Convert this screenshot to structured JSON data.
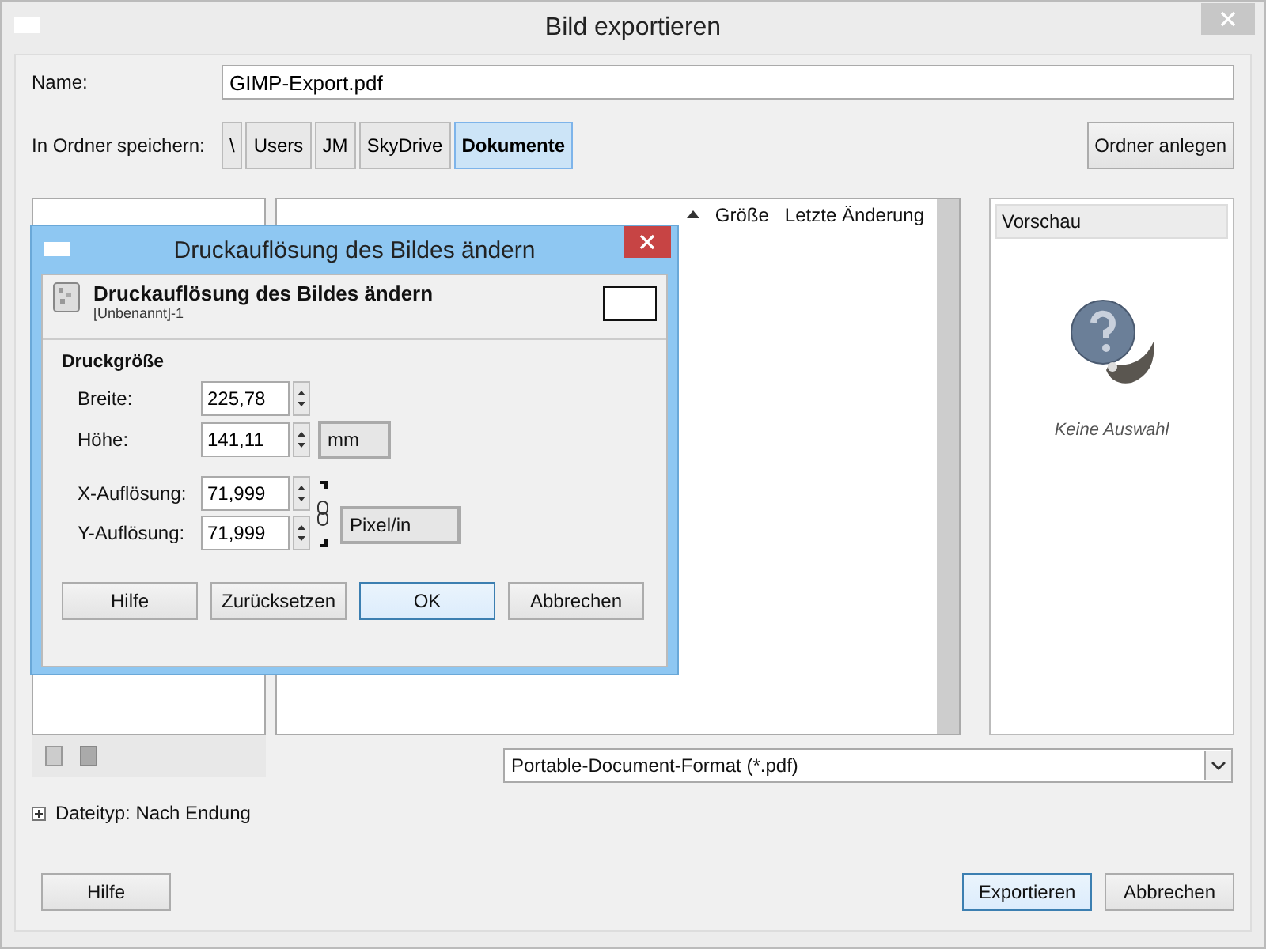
{
  "window": {
    "title": "Bild exportieren"
  },
  "name_field": {
    "label": "Name:",
    "value": "GIMP-Export.pdf"
  },
  "folder": {
    "label": "In Ordner speichern:",
    "crumbs": [
      {
        "label": "\\",
        "selected": false
      },
      {
        "label": "Users",
        "selected": false
      },
      {
        "label": "JM",
        "selected": false
      },
      {
        "label": "SkyDrive",
        "selected": false
      },
      {
        "label": "Dokumente",
        "selected": true
      }
    ],
    "create_button": "Ordner anlegen"
  },
  "file_list": {
    "columns": [
      "Größe",
      "Letzte Änderung"
    ]
  },
  "preview": {
    "title": "Vorschau",
    "caption": "Keine Auswahl"
  },
  "filetype_select": "Portable-Document-Format (*.pdf)",
  "filetype_expander": {
    "label": "Dateityp: Nach Endung",
    "expanded": false
  },
  "buttons": [
    {
      "label": "Hilfe",
      "default": false
    },
    {
      "label": "Exportieren",
      "default": true
    },
    {
      "label": "Abbrechen",
      "default": false
    }
  ],
  "dialog": {
    "title": "Druckauflösung des Bildes ändern",
    "heading": "Druckauflösung des Bildes ändern",
    "subheading": "[Unbenannt]-1",
    "section": "Druckgröße",
    "fields": [
      {
        "label": "Breite:",
        "value": "225,78"
      },
      {
        "label": "Höhe:",
        "value": "141,11"
      },
      {
        "label": "X-Auflösung:",
        "value": "71,999"
      },
      {
        "label": "Y-Auflösung:",
        "value": "71,999"
      }
    ],
    "size_unit": "mm",
    "resolution_unit": "Pixel/in",
    "buttons": [
      {
        "label": "Hilfe",
        "default": false
      },
      {
        "label": "Zurücksetzen",
        "default": false
      },
      {
        "label": "OK",
        "default": true
      },
      {
        "label": "Abbrechen",
        "default": false
      }
    ]
  }
}
